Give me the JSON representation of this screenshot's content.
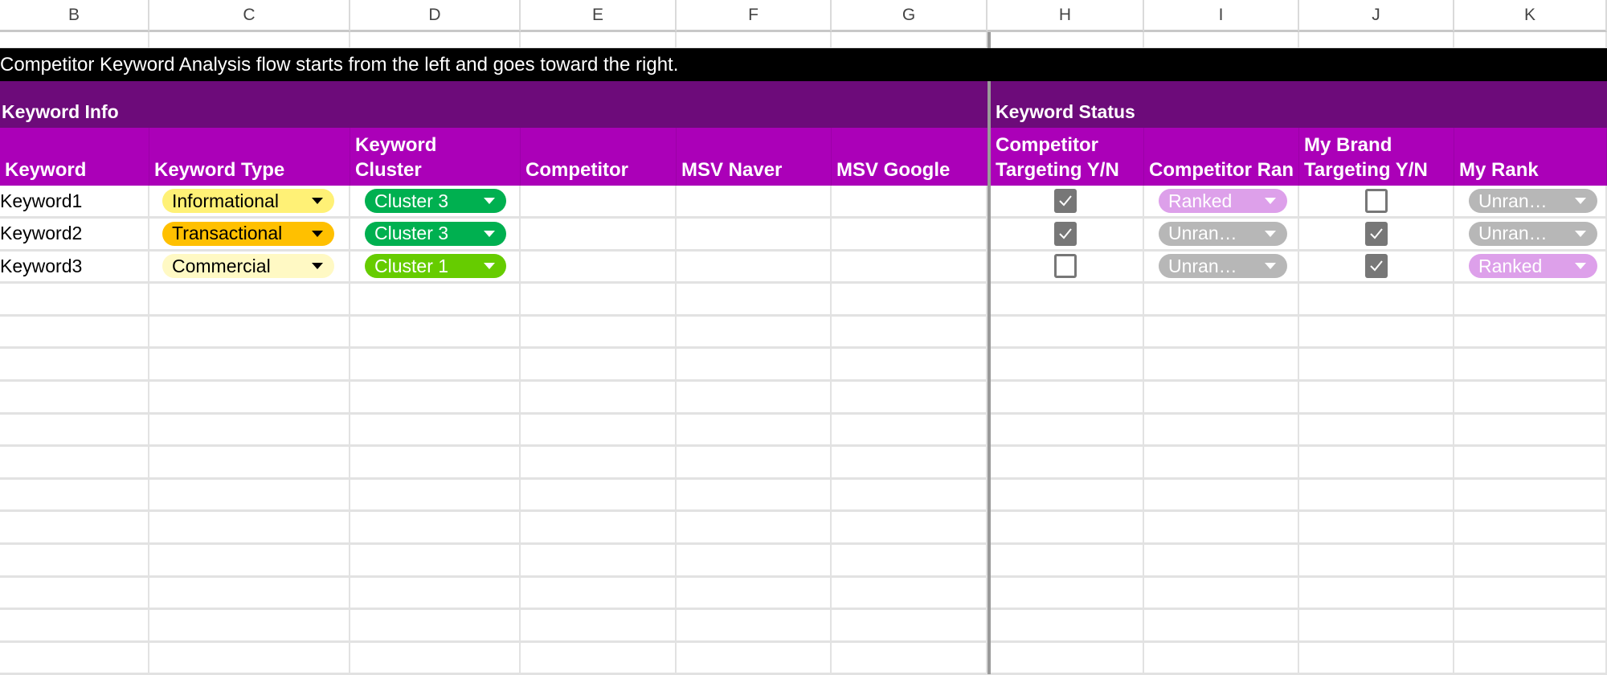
{
  "columns": [
    "B",
    "C",
    "D",
    "E",
    "F",
    "G",
    "H",
    "I",
    "J",
    "K"
  ],
  "banner_text": "Competitor Keyword Analysis flow starts from the left and goes toward the right.",
  "sections": {
    "keyword_info": "Keyword Info",
    "keyword_status": "Keyword Status"
  },
  "headers": {
    "keyword": "Keyword",
    "keyword_type": "Keyword Type",
    "keyword_cluster_1": "Keyword",
    "keyword_cluster_2": "Cluster",
    "competitor": "Competitor",
    "msv_naver": "MSV Naver",
    "msv_google": "MSV Google",
    "competitor_targeting_1": "Competitor",
    "competitor_targeting_2": "Targeting Y/N",
    "competitor_rank": "Competitor Ran",
    "my_brand_targeting_1": "My Brand",
    "my_brand_targeting_2": "Targeting Y/N",
    "my_rank": "My Rank"
  },
  "rows": [
    {
      "keyword": "Keyword1",
      "type": "Informational",
      "type_color": "#fff176",
      "cluster": "Cluster 3",
      "cluster_color": "#00b050",
      "competitor": "",
      "msv_naver": "",
      "msv_google": "",
      "competitor_targeting": true,
      "competitor_rank": "Ranked",
      "competitor_rank_color": "#dda0ea",
      "my_brand_targeting": false,
      "my_rank": "Unran…",
      "my_rank_color": "#b7b7b7"
    },
    {
      "keyword": "Keyword2",
      "type": "Transactional",
      "type_color": "#ffc000",
      "cluster": "Cluster 3",
      "cluster_color": "#00b050",
      "competitor": "",
      "msv_naver": "",
      "msv_google": "",
      "competitor_targeting": true,
      "competitor_rank": "Unran…",
      "competitor_rank_color": "#b7b7b7",
      "my_brand_targeting": true,
      "my_rank": "Unran…",
      "my_rank_color": "#b7b7b7"
    },
    {
      "keyword": "Keyword3",
      "type": "Commercial",
      "type_color": "#fff9c4",
      "cluster": "Cluster 1",
      "cluster_color": "#66cc00",
      "competitor": "",
      "msv_naver": "",
      "msv_google": "",
      "competitor_targeting": false,
      "competitor_rank": "Unran…",
      "competitor_rank_color": "#b7b7b7",
      "my_brand_targeting": true,
      "my_rank": "Ranked",
      "my_rank_color": "#dda0ea"
    }
  ],
  "empty_row_count": 12
}
